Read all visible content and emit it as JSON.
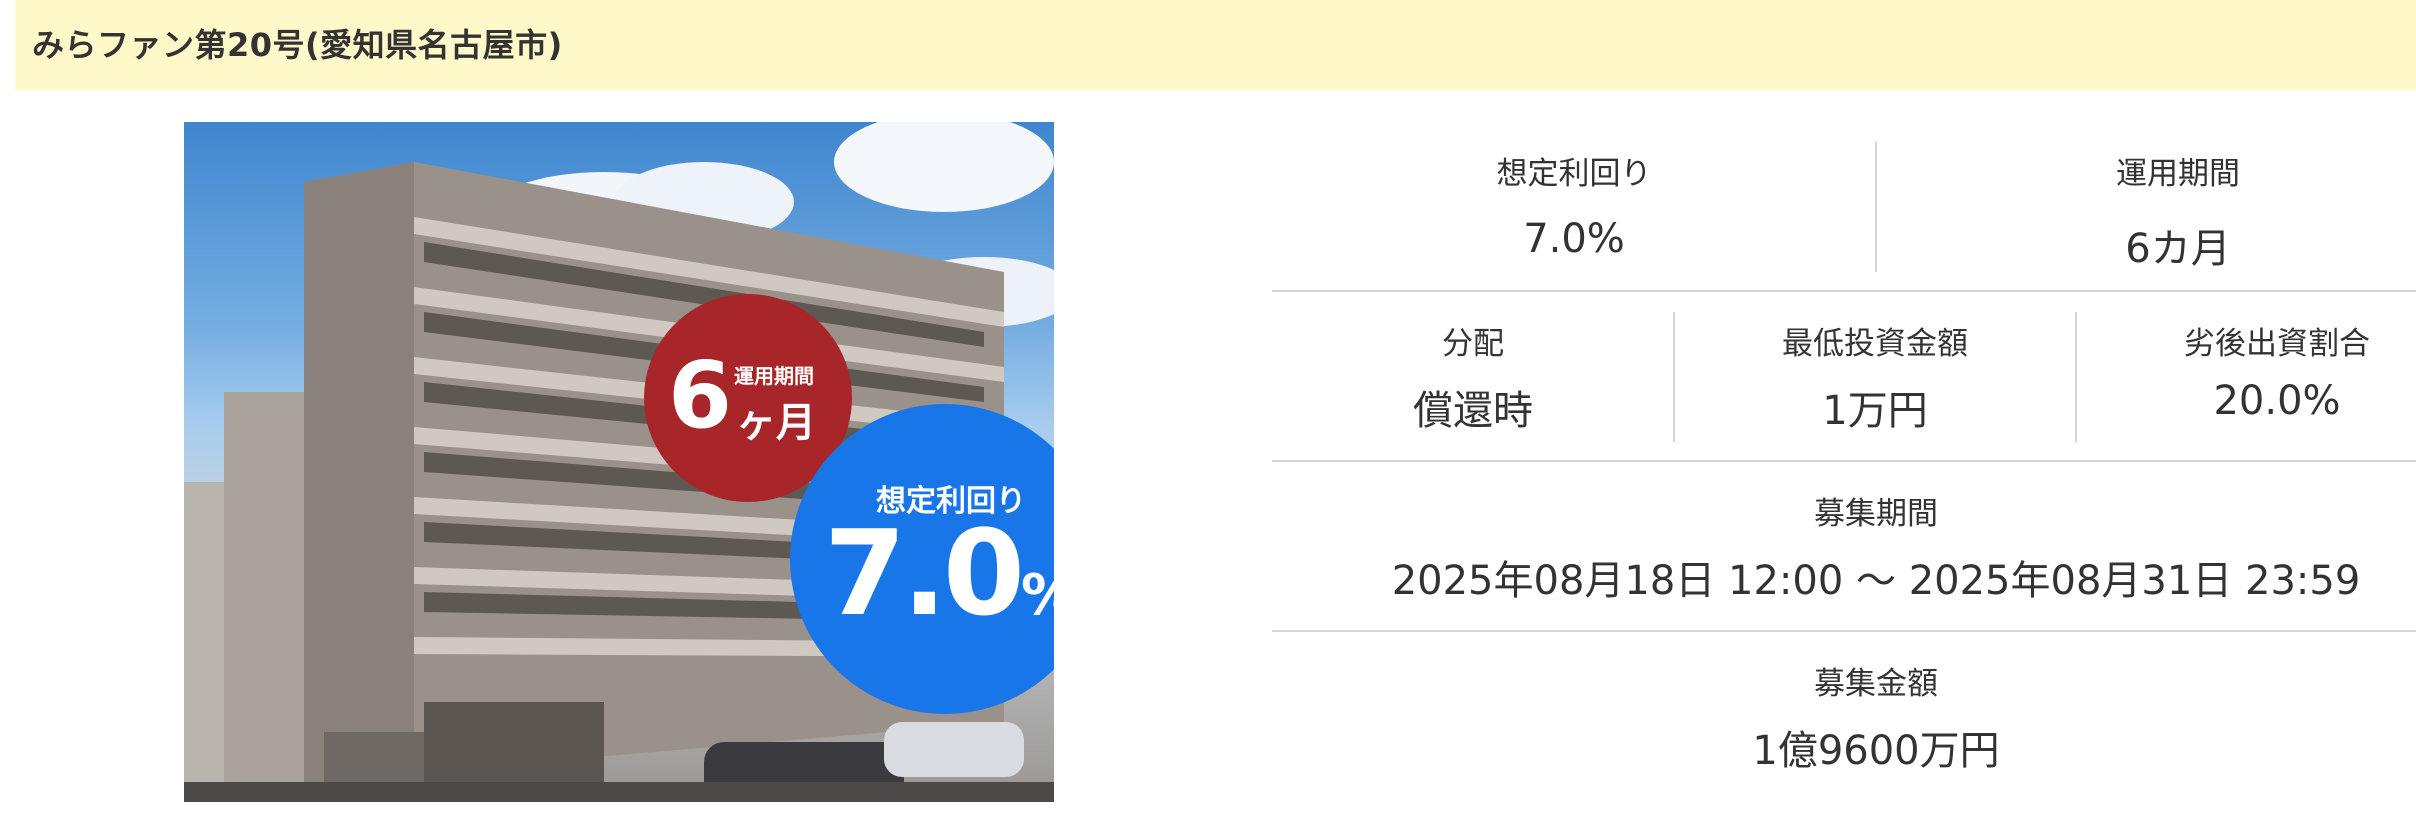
{
  "header": {
    "title": "みらファン第20号(愛知県名古屋市)"
  },
  "photo": {
    "period_badge": {
      "caption": "運用期間",
      "number": "6",
      "unit": "ヶ月"
    },
    "yield_badge": {
      "caption": "想定利回り",
      "number": "7.0",
      "unit": "%"
    }
  },
  "details": {
    "expected_yield": {
      "label": "想定利回り",
      "value": "7.0%"
    },
    "operation_period": {
      "label": "運用期間",
      "value": "6カ月"
    },
    "distribution": {
      "label": "分配",
      "value": "償還時"
    },
    "minimum_investment": {
      "label": "最低投資金額",
      "value": "1万円"
    },
    "subordinated_ratio": {
      "label": "劣後出資割合",
      "value": "20.0%"
    },
    "recruitment_period": {
      "label": "募集期間",
      "value": "2025年08月18日 12:00 〜 2025年08月31日 23:59"
    },
    "recruitment_amount": {
      "label": "募集金額",
      "value": "1億9600万円"
    }
  },
  "colors": {
    "title_bar_bg": "#fff8c8",
    "period_badge": "#a8262a",
    "yield_badge": "#1976e8",
    "divider": "#d6d6d6"
  }
}
